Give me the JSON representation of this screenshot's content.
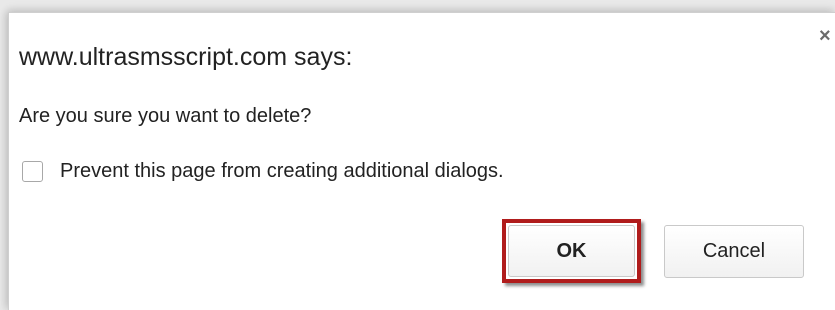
{
  "dialog": {
    "title": "www.ultrasmsscript.com says:",
    "message": "Are you sure you want to delete?",
    "prevent_checkbox": {
      "label": "Prevent this page from creating additional dialogs.",
      "checked": false
    },
    "close_glyph": "×",
    "buttons": {
      "ok_label": "OK",
      "cancel_label": "Cancel"
    },
    "highlight_color": "#b01c1c"
  }
}
